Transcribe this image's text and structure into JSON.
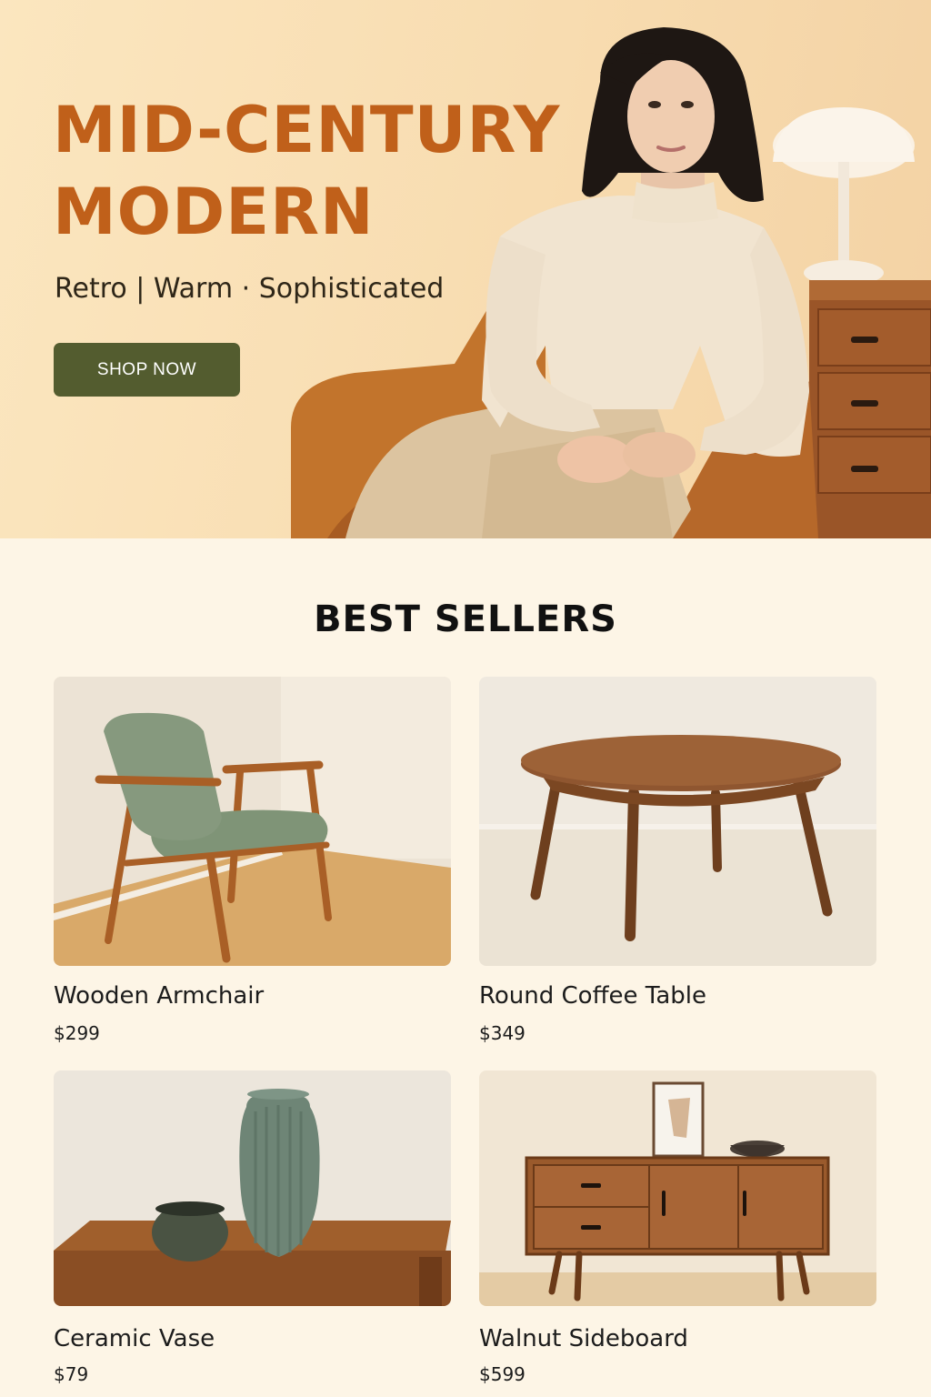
{
  "hero": {
    "title_line1": "MID-CENTURY",
    "title_line2": "MODERN",
    "tagline": "Retro | Warm · Sophisticated",
    "cta_label": "SHOP NOW"
  },
  "best_sellers": {
    "title": "BEST SELLERS",
    "products": [
      {
        "name": "Wooden Armchair",
        "price": "$299"
      },
      {
        "name": "Round Coffee Table",
        "price": "$349"
      },
      {
        "name": "Ceramic Vase",
        "price": "$79"
      },
      {
        "name": "Walnut Sideboard",
        "price": "$599"
      }
    ]
  },
  "colors": {
    "hero_title": "#c0601a",
    "cta_background": "#535c2f",
    "page_background": "#fdf5e6",
    "walnut": "#8a4e24",
    "sage": "#7f9477"
  }
}
